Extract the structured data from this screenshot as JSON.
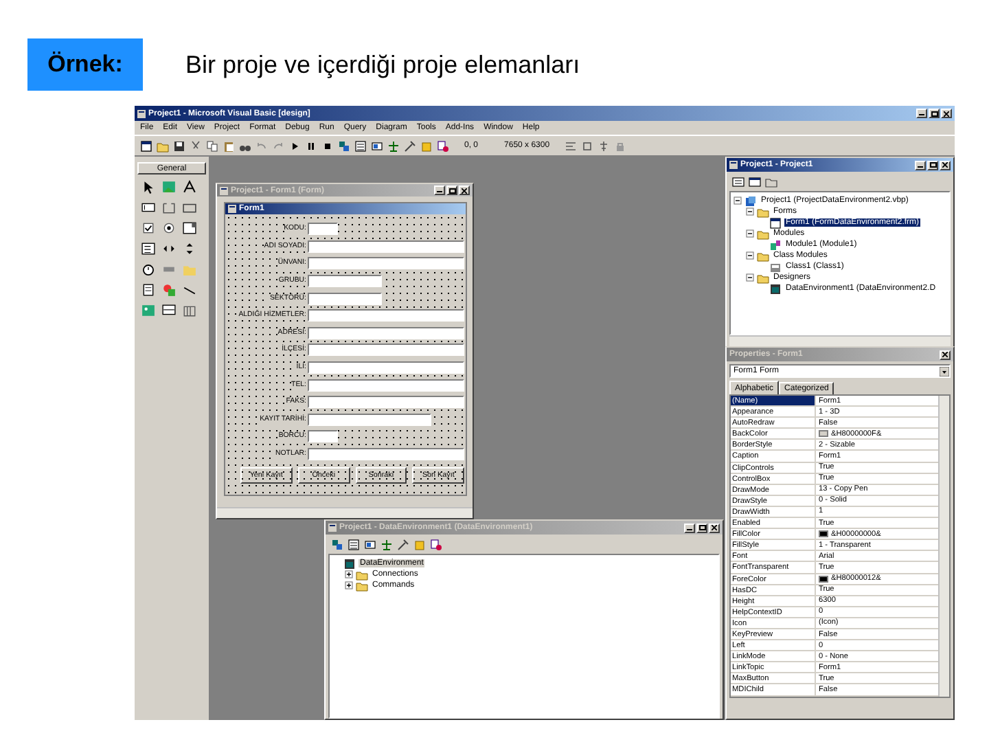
{
  "slide": {
    "badge": "Örnek:",
    "title": "Bir proje ve içerdiği proje elemanları"
  },
  "ide": {
    "title": "Project1 - Microsoft Visual Basic [design]",
    "menu": [
      "File",
      "Edit",
      "View",
      "Project",
      "Format",
      "Debug",
      "Run",
      "Query",
      "Diagram",
      "Tools",
      "Add-Ins",
      "Window",
      "Help"
    ],
    "position": "0, 0",
    "size": "7650 x 6300"
  },
  "toolbox": {
    "tab": "General"
  },
  "form_window": {
    "title": "Project1 - Form1 (Form)",
    "form_title": "Form1",
    "fields": [
      {
        "label": "KODU:",
        "kind": "short"
      },
      {
        "label": "ADI SOYADI:",
        "kind": "long"
      },
      {
        "label": "ÜNVANI:",
        "kind": "long"
      },
      {
        "label": "GRUBU:",
        "kind": "medium"
      },
      {
        "label": "SEKTÖRÜ:",
        "kind": "medium"
      },
      {
        "label": "ALDIĞI HİZMETLER:",
        "kind": "long"
      },
      {
        "label": "ADRESİ:",
        "kind": "long"
      },
      {
        "label": "İLÇESİ:",
        "kind": "long"
      },
      {
        "label": "İLİ:",
        "kind": "long"
      },
      {
        "label": "TEL:",
        "kind": "long"
      },
      {
        "label": "FAKS:",
        "kind": "long"
      },
      {
        "label": "KAYIT TARİHİ:",
        "kind": "wide"
      },
      {
        "label": "BORCU:",
        "kind": "short"
      },
      {
        "label": "NOTLAR:",
        "kind": "long"
      }
    ],
    "buttons": [
      "Yeni Kayıt",
      "Önceki",
      "Sonraki",
      "Son Kayıt"
    ]
  },
  "project": {
    "title": "Project1 - Project1",
    "tree": [
      {
        "label": "Project1 (ProjectDataEnvironment2.vbp)",
        "kind": "project",
        "expanded": true,
        "selected": false,
        "children": [
          {
            "label": "Forms",
            "kind": "folder",
            "expanded": true,
            "selected": false,
            "children": [
              {
                "label": "Form1 (FormDataEnvironment2.frm)",
                "kind": "form",
                "selected": true
              }
            ]
          },
          {
            "label": "Modules",
            "kind": "folder",
            "expanded": true,
            "selected": false,
            "children": [
              {
                "label": "Module1 (Module1)",
                "kind": "module",
                "selected": false
              }
            ]
          },
          {
            "label": "Class Modules",
            "kind": "folder",
            "expanded": true,
            "selected": false,
            "children": [
              {
                "label": "Class1 (Class1)",
                "kind": "class",
                "selected": false
              }
            ]
          },
          {
            "label": "Designers",
            "kind": "folder",
            "expanded": true,
            "selected": false,
            "children": [
              {
                "label": "DataEnvironment1 (DataEnvironment2.D",
                "kind": "designer",
                "selected": false
              }
            ]
          }
        ]
      }
    ]
  },
  "properties": {
    "title": "Properties - Form1",
    "object": "Form1 Form",
    "tabs": [
      {
        "label": "Alphabetic",
        "selected": true
      },
      {
        "label": "Categorized",
        "selected": false
      }
    ],
    "rows": [
      {
        "name": "(Name)",
        "value": "Form1",
        "selected": true
      },
      {
        "name": "Appearance",
        "value": "1 - 3D",
        "selected": false
      },
      {
        "name": "AutoRedraw",
        "value": "False",
        "selected": false
      },
      {
        "name": "BackColor",
        "value": "&H8000000F&",
        "color": "#d4d0c8",
        "selected": false
      },
      {
        "name": "BorderStyle",
        "value": "2 - Sizable",
        "selected": false
      },
      {
        "name": "Caption",
        "value": "Form1",
        "selected": false
      },
      {
        "name": "ClipControls",
        "value": "True",
        "selected": false
      },
      {
        "name": "ControlBox",
        "value": "True",
        "selected": false
      },
      {
        "name": "DrawMode",
        "value": "13 - Copy Pen",
        "selected": false
      },
      {
        "name": "DrawStyle",
        "value": "0 - Solid",
        "selected": false
      },
      {
        "name": "DrawWidth",
        "value": "1",
        "selected": false
      },
      {
        "name": "Enabled",
        "value": "True",
        "selected": false
      },
      {
        "name": "FillColor",
        "value": "&H00000000&",
        "color": "#000000",
        "selected": false
      },
      {
        "name": "FillStyle",
        "value": "1 - Transparent",
        "selected": false
      },
      {
        "name": "Font",
        "value": "Arial",
        "selected": false
      },
      {
        "name": "FontTransparent",
        "value": "True",
        "selected": false
      },
      {
        "name": "ForeColor",
        "value": "&H80000012&",
        "color": "#000000",
        "selected": false
      },
      {
        "name": "HasDC",
        "value": "True",
        "selected": false
      },
      {
        "name": "Height",
        "value": "6300",
        "selected": false
      },
      {
        "name": "HelpContextID",
        "value": "0",
        "selected": false
      },
      {
        "name": "Icon",
        "value": "(Icon)",
        "selected": false
      },
      {
        "name": "KeyPreview",
        "value": "False",
        "selected": false
      },
      {
        "name": "Left",
        "value": "0",
        "selected": false
      },
      {
        "name": "LinkMode",
        "value": "0 - None",
        "selected": false
      },
      {
        "name": "LinkTopic",
        "value": "Form1",
        "selected": false
      },
      {
        "name": "MaxButton",
        "value": "True",
        "selected": false
      },
      {
        "name": "MDIChild",
        "value": "False",
        "selected": false
      }
    ]
  },
  "data_env": {
    "title": "Project1 - DataEnvironment1 (DataEnvironment1)",
    "tree": [
      {
        "label": "DataEnvironment",
        "kind": "designer",
        "selected": true,
        "children": [
          {
            "label": "Connections",
            "kind": "folder",
            "expanded": false,
            "selected": false
          },
          {
            "label": "Commands",
            "kind": "folder",
            "expanded": false,
            "selected": false
          }
        ]
      }
    ]
  }
}
